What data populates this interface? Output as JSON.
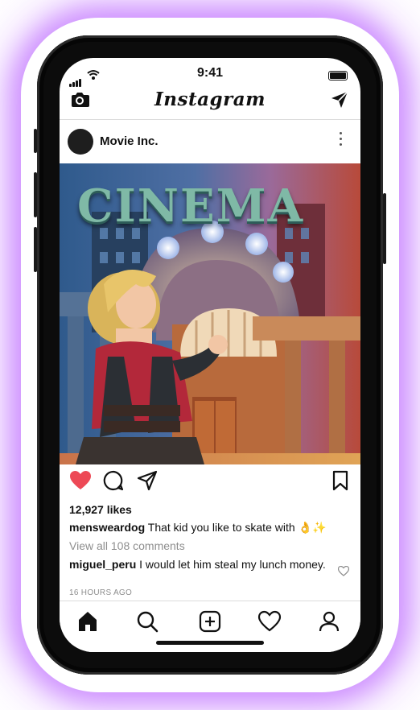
{
  "status_bar": {
    "time": "9:41"
  },
  "app": {
    "title": "Instagram"
  },
  "post": {
    "username": "Movie Inc.",
    "image_sign_text": "CINEMA",
    "likes_text": "12,927 likes",
    "caption": {
      "username": "mensweardog",
      "text": "That kid you like to skate with 👌✨"
    },
    "view_all_comments": "View all 108 comments",
    "comment": {
      "username": "miguel_peru",
      "text": "I would let him steal my lunch money."
    },
    "time_ago": "16 HOURS AGO",
    "liked": true
  },
  "icons": {
    "top_left": "camera-icon",
    "top_right": "direct-send-icon",
    "post_menu": "more-vertical-icon",
    "actions": [
      "heart-filled-icon",
      "comment-icon",
      "share-icon",
      "bookmark-icon"
    ],
    "comment_like": "heart-outline-icon",
    "nav": [
      "home-icon",
      "search-icon",
      "add-post-icon",
      "activity-heart-icon",
      "profile-icon"
    ]
  },
  "colors": {
    "like_red": "#ed4956",
    "glow": "#b45aff",
    "muted_text": "#8e8e8e"
  }
}
